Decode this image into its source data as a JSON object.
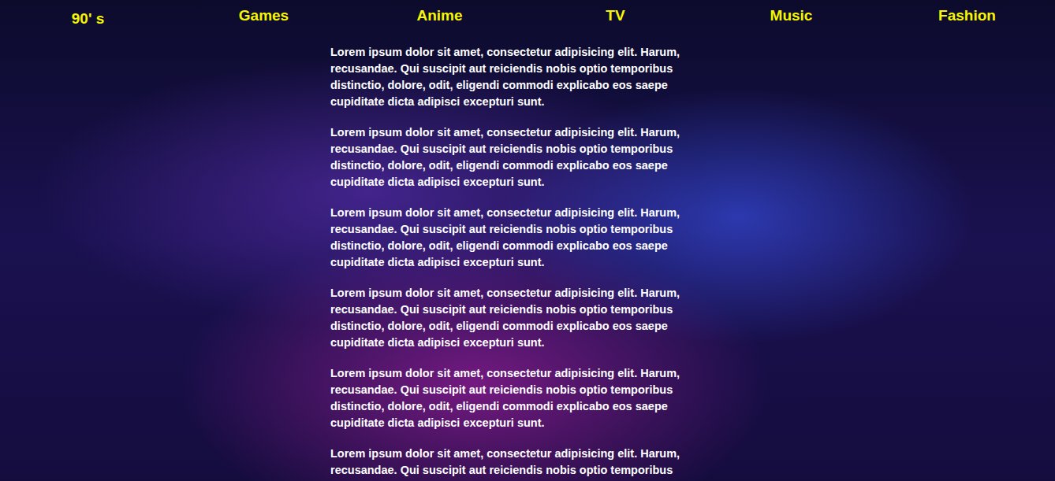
{
  "nav": {
    "logo": "90' s",
    "items": [
      "Games",
      "Anime",
      "TV",
      "Music",
      "Fashion"
    ]
  },
  "content": {
    "paragraphs": [
      "Lorem ipsum dolor sit amet, consectetur adipisicing elit. Harum, recusandae. Qui suscipit aut reiciendis nobis optio temporibus distinctio, dolore, odit, eligendi commodi explicabo eos saepe cupiditate dicta adipisci excepturi sunt.",
      "Lorem ipsum dolor sit amet, consectetur adipisicing elit. Harum, recusandae. Qui suscipit aut reiciendis nobis optio temporibus distinctio, dolore, odit, eligendi commodi explicabo eos saepe cupiditate dicta adipisci excepturi sunt.",
      "Lorem ipsum dolor sit amet, consectetur adipisicing elit. Harum, recusandae. Qui suscipit aut reiciendis nobis optio temporibus distinctio, dolore, odit, eligendi commodi explicabo eos saepe cupiditate dicta adipisci excepturi sunt.",
      "Lorem ipsum dolor sit amet, consectetur adipisicing elit. Harum, recusandae. Qui suscipit aut reiciendis nobis optio temporibus distinctio, dolore, odit, eligendi commodi explicabo eos saepe cupiditate dicta adipisci excepturi sunt.",
      "Lorem ipsum dolor sit amet, consectetur adipisicing elit. Harum, recusandae. Qui suscipit aut reiciendis nobis optio temporibus distinctio, dolore, odit, eligendi commodi explicabo eos saepe cupiditate dicta adipisci excepturi sunt.",
      "Lorem ipsum dolor sit amet, consectetur adipisicing elit. Harum, recusandae. Qui suscipit aut reiciendis nobis optio temporibus"
    ]
  }
}
